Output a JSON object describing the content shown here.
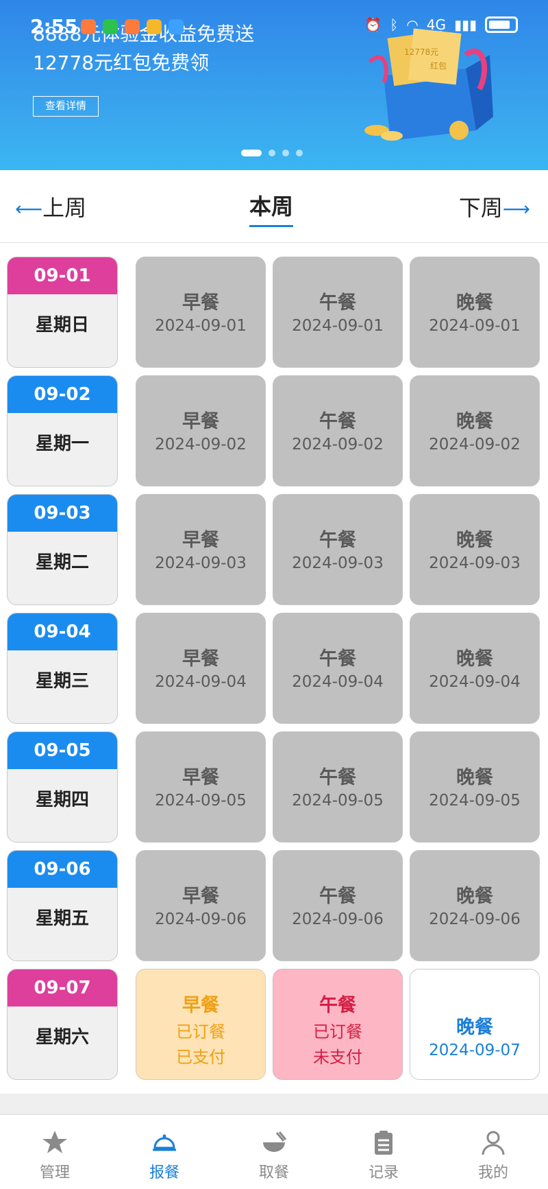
{
  "status_bar": {
    "time": "2:55",
    "network": "4G"
  },
  "banner": {
    "line1": "8888元体验金收益免费送",
    "line2": "12778元红包免费领",
    "details_button": "查看详情",
    "giftbox_texts": [
      "12778元",
      "红包"
    ],
    "dots": 4,
    "active_dot": 0
  },
  "weeknav": {
    "prev": "上周",
    "current": "本周",
    "next": "下周"
  },
  "days": [
    {
      "date": "09-01",
      "weekday": "星期日",
      "color": "#de3f9c",
      "meals": [
        {
          "name": "早餐",
          "line2": "2024-09-01",
          "state": "past"
        },
        {
          "name": "午餐",
          "line2": "2024-09-01",
          "state": "past"
        },
        {
          "name": "晚餐",
          "line2": "2024-09-01",
          "state": "past"
        }
      ]
    },
    {
      "date": "09-02",
      "weekday": "星期一",
      "color": "#1a8cf0",
      "meals": [
        {
          "name": "早餐",
          "line2": "2024-09-02",
          "state": "past"
        },
        {
          "name": "午餐",
          "line2": "2024-09-02",
          "state": "past"
        },
        {
          "name": "晚餐",
          "line2": "2024-09-02",
          "state": "past"
        }
      ]
    },
    {
      "date": "09-03",
      "weekday": "星期二",
      "color": "#1a8cf0",
      "meals": [
        {
          "name": "早餐",
          "line2": "2024-09-03",
          "state": "past"
        },
        {
          "name": "午餐",
          "line2": "2024-09-03",
          "state": "past"
        },
        {
          "name": "晚餐",
          "line2": "2024-09-03",
          "state": "past"
        }
      ]
    },
    {
      "date": "09-04",
      "weekday": "星期三",
      "color": "#1a8cf0",
      "meals": [
        {
          "name": "早餐",
          "line2": "2024-09-04",
          "state": "past"
        },
        {
          "name": "午餐",
          "line2": "2024-09-04",
          "state": "past"
        },
        {
          "name": "晚餐",
          "line2": "2024-09-04",
          "state": "past"
        }
      ]
    },
    {
      "date": "09-05",
      "weekday": "星期四",
      "color": "#1a8cf0",
      "meals": [
        {
          "name": "早餐",
          "line2": "2024-09-05",
          "state": "past"
        },
        {
          "name": "午餐",
          "line2": "2024-09-05",
          "state": "past"
        },
        {
          "name": "晚餐",
          "line2": "2024-09-05",
          "state": "past"
        }
      ]
    },
    {
      "date": "09-06",
      "weekday": "星期五",
      "color": "#1a8cf0",
      "meals": [
        {
          "name": "早餐",
          "line2": "2024-09-06",
          "state": "past"
        },
        {
          "name": "午餐",
          "line2": "2024-09-06",
          "state": "past"
        },
        {
          "name": "晚餐",
          "line2": "2024-09-06",
          "state": "past"
        }
      ]
    },
    {
      "date": "09-07",
      "weekday": "星期六",
      "color": "#de3f9c",
      "meals": [
        {
          "name": "早餐",
          "line2": "已订餐",
          "line3": "已支付",
          "state": "paid"
        },
        {
          "name": "午餐",
          "line2": "已订餐",
          "line3": "未支付",
          "state": "unpaid"
        },
        {
          "name": "晚餐",
          "line2": "2024-09-07",
          "state": "avail"
        }
      ]
    }
  ],
  "tabs": [
    {
      "label": "管理",
      "icon": "star-icon",
      "active": false
    },
    {
      "label": "报餐",
      "icon": "cloche-icon",
      "active": true
    },
    {
      "label": "取餐",
      "icon": "bowl-icon",
      "active": false
    },
    {
      "label": "记录",
      "icon": "clipboard-icon",
      "active": false
    },
    {
      "label": "我的",
      "icon": "person-icon",
      "active": false
    }
  ],
  "colors": {
    "accent": "#1a7fd8",
    "weekend": "#de3f9c",
    "weekday": "#1a8cf0"
  }
}
